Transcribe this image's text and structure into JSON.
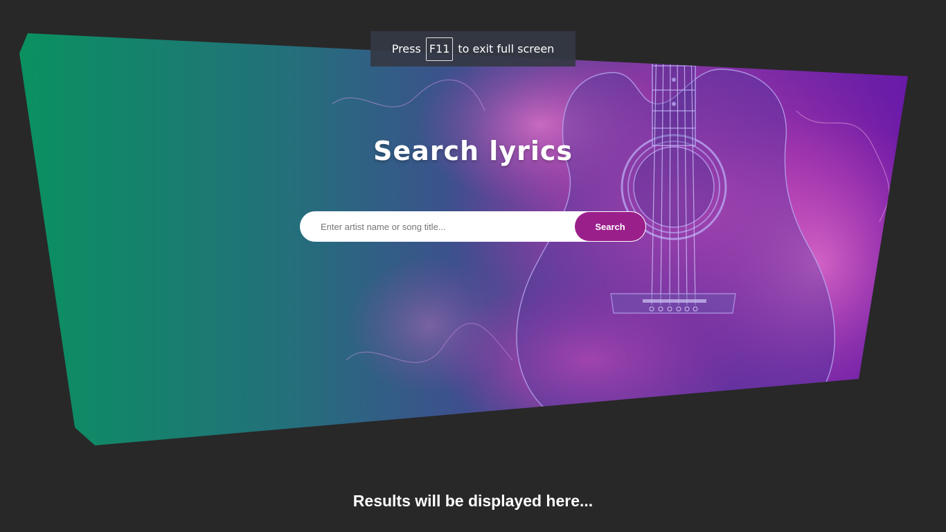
{
  "fullscreen_notice": {
    "prefix": "Press",
    "key": "F11",
    "suffix": "to exit full screen"
  },
  "header": {
    "title": "Search lyrics"
  },
  "search": {
    "placeholder": "Enter artist name or song title...",
    "value": "",
    "button_label": "Search"
  },
  "results": {
    "message": "Results will be displayed here..."
  },
  "colors": {
    "page_background": "#282828",
    "gradient_start": "#0a9160",
    "gradient_mid": "#3b4f8f",
    "gradient_end": "#b02aa8",
    "button": "#9b1f8b"
  },
  "icons": {
    "hero_illustration": "guitar-in-flames"
  }
}
